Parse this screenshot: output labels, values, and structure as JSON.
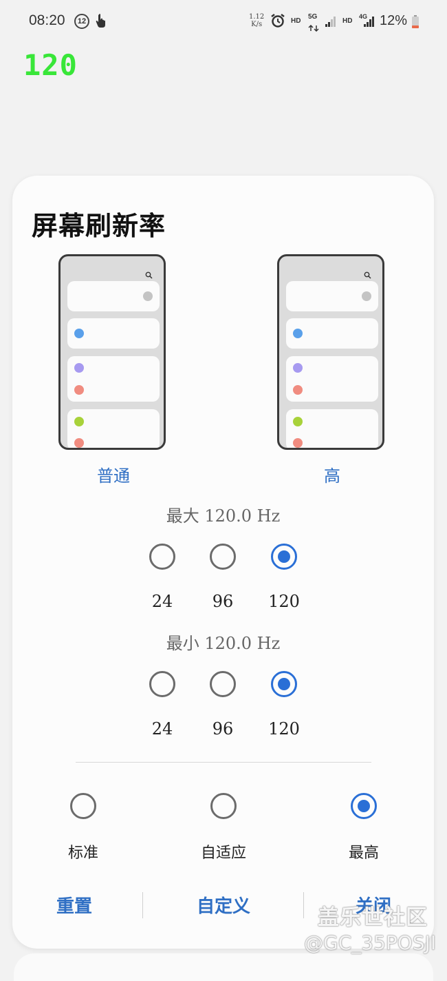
{
  "status_bar": {
    "time": "08:20",
    "notification_count": "12",
    "net_speed_value": "1.12",
    "net_speed_unit": "K/s",
    "hd1": "HD",
    "net5g": "5G",
    "hd2": "HD",
    "net4g": "4G",
    "battery": "12%"
  },
  "fps_overlay": "120",
  "dialog": {
    "title": "屏幕刷新率",
    "modes": [
      "普通",
      "高"
    ],
    "max": {
      "label": "最大 120.0 Hz",
      "options": [
        "24",
        "96",
        "120"
      ],
      "selected": "120"
    },
    "min": {
      "label": "最小 120.0 Hz",
      "options": [
        "24",
        "96",
        "120"
      ],
      "selected": "120"
    },
    "presets": {
      "options": [
        "标准",
        "自适应",
        "最高"
      ],
      "selected": "最高"
    },
    "buttons": {
      "reset": "重置",
      "custom": "自定义",
      "close": "关闭"
    }
  },
  "watermark": {
    "line1": "盖乐世社区",
    "line2": "@GC_35POSJI"
  },
  "colors": {
    "accent": "#2a6fd6",
    "fps_text": "#39e639",
    "dot_blue": "#5aa0ea",
    "dot_purple": "#a79af0",
    "dot_red": "#f08c80",
    "dot_green": "#a8d23a",
    "dot_gray": "#c4c4c4"
  }
}
